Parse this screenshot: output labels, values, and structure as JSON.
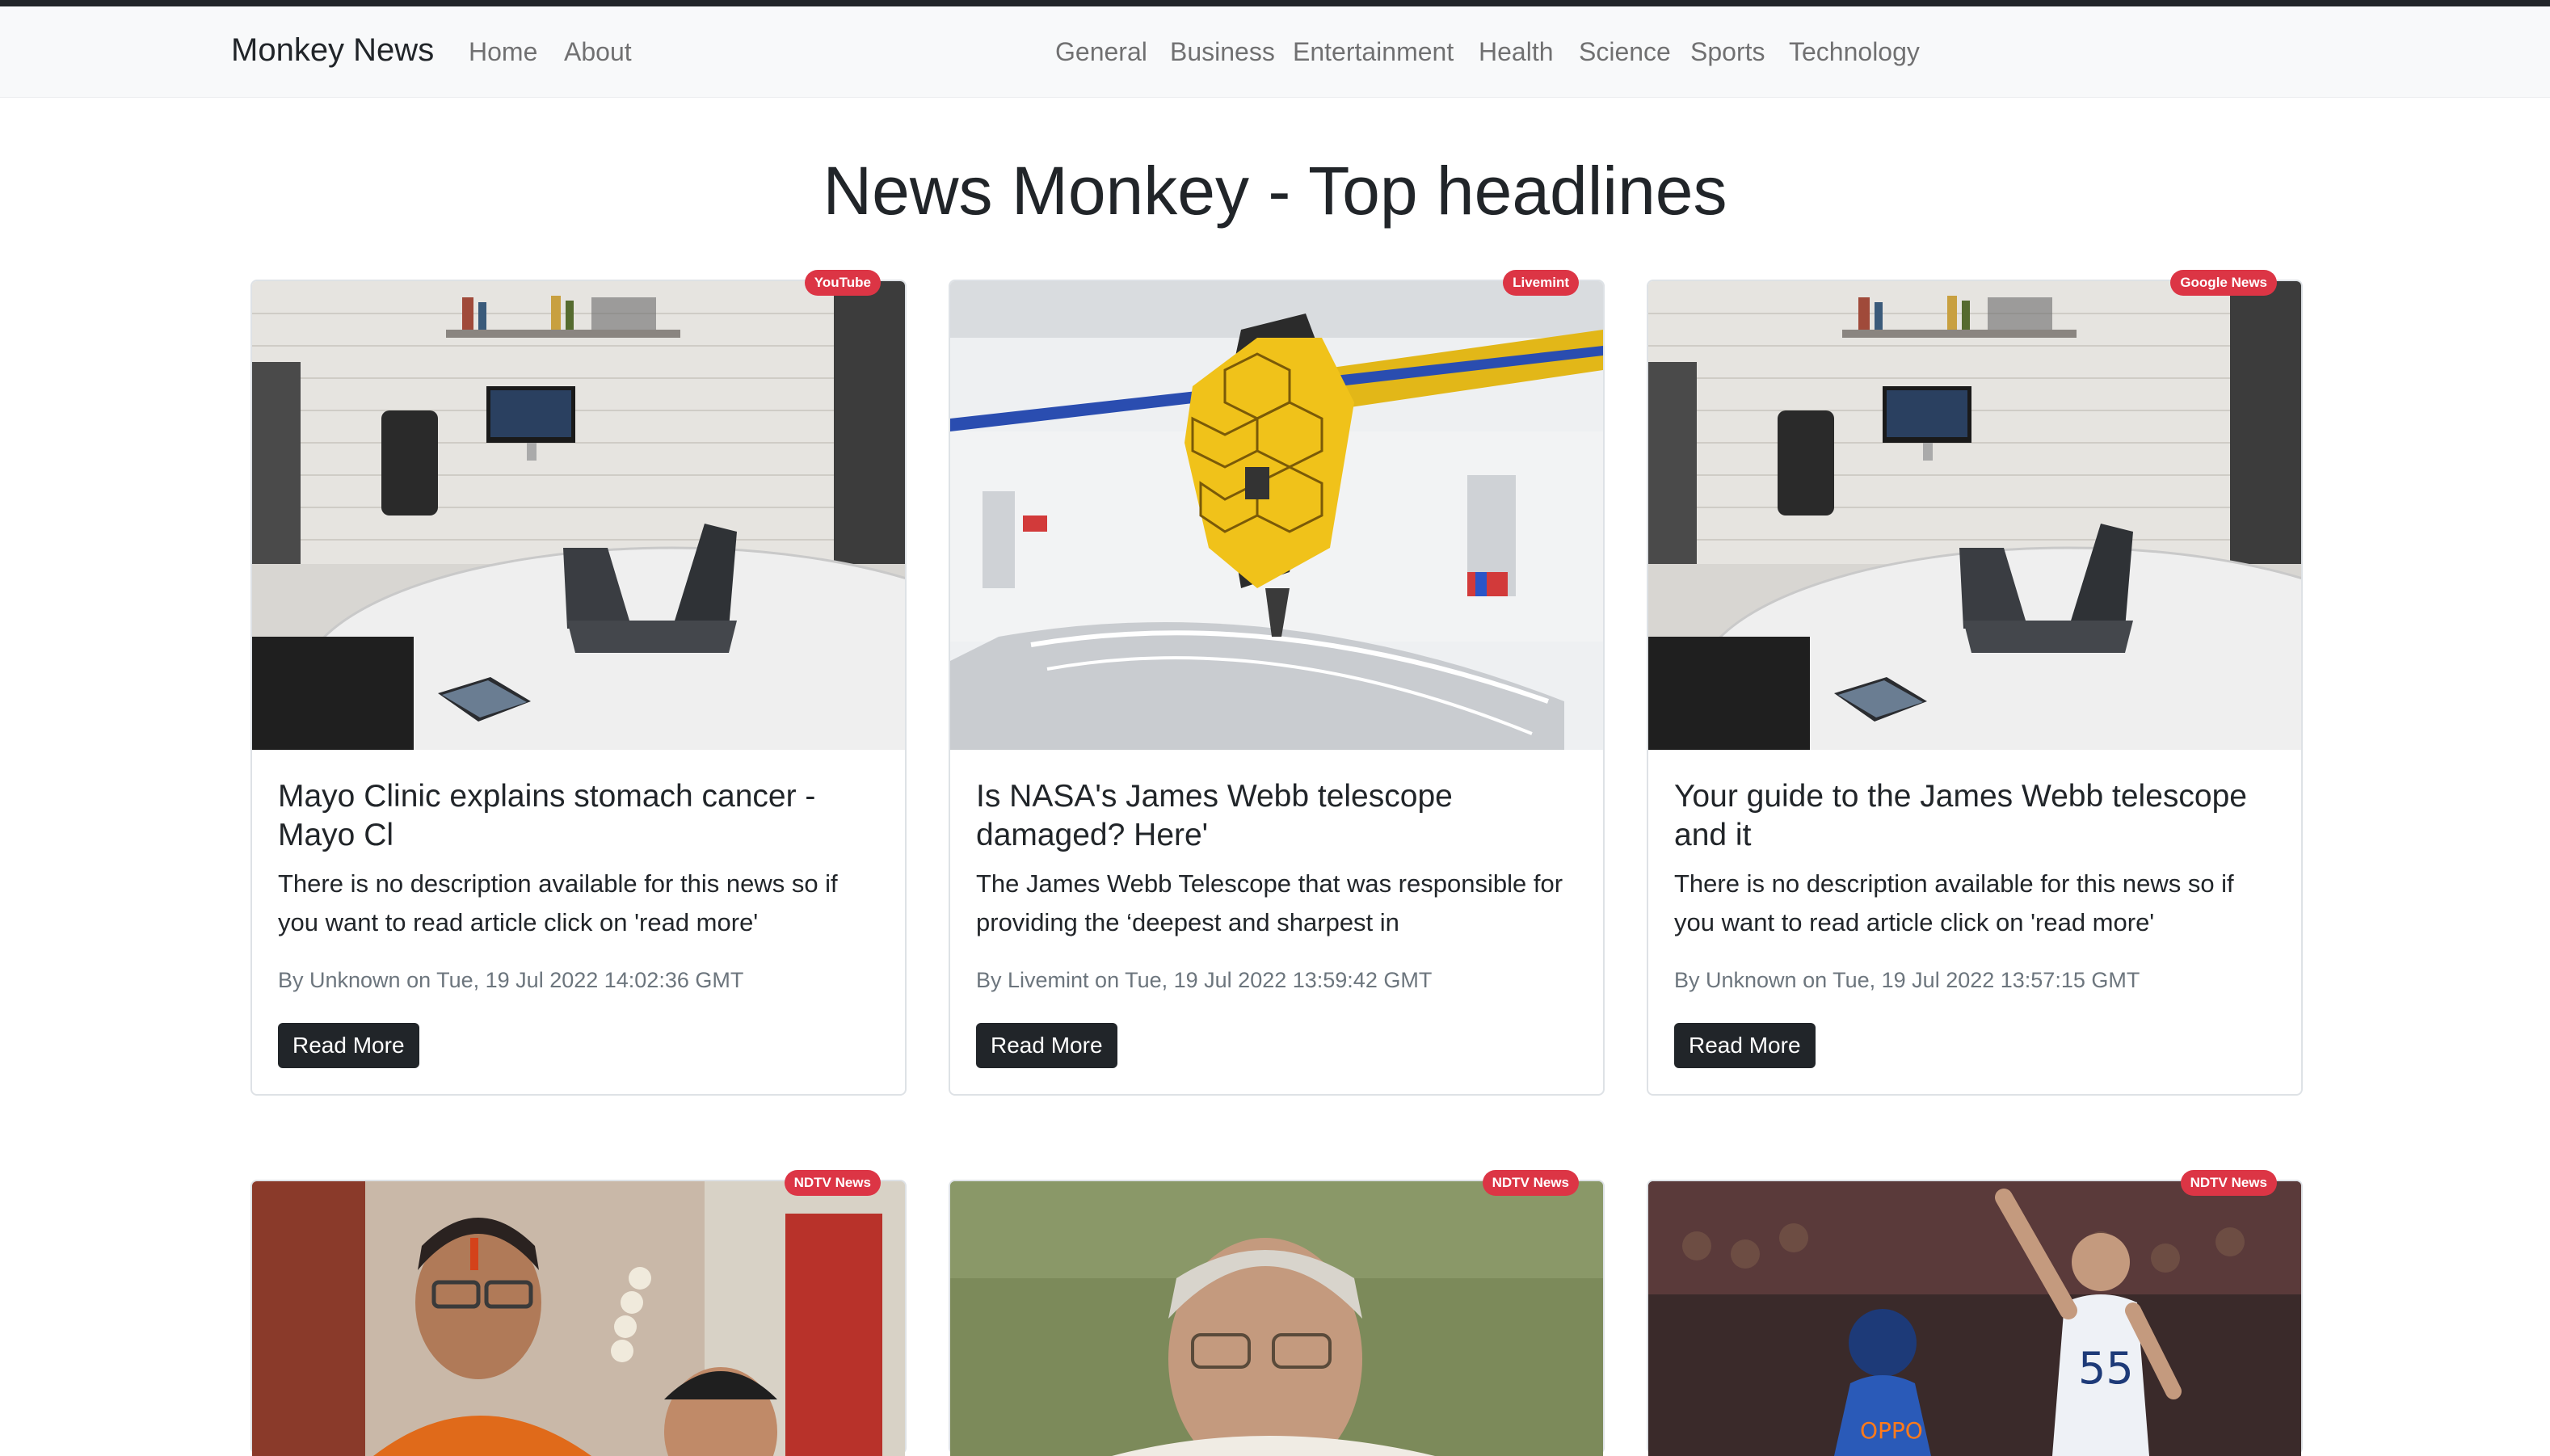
{
  "navbar": {
    "brand": "Monkey News",
    "links": [
      "Home",
      "About"
    ],
    "categories": [
      "General",
      "Business",
      "Entertainment",
      "Health",
      "Science",
      "Sports",
      "Technology"
    ]
  },
  "page": {
    "title": "News Monkey - Top headlines"
  },
  "colors": {
    "badge": "#dc3545",
    "button": "#212529",
    "navbar_bg": "#f8f9fa"
  },
  "articles": [
    {
      "source": "YouTube",
      "title": "Mayo Clinic explains stomach cancer - Mayo Cl",
      "description": "There is no description available for this news so if you want to read article click on 'read more'",
      "meta": "By Unknown on Tue, 19 Jul 2022 14:02:36 GMT",
      "button": "Read More",
      "image": "router-on-desk-photo"
    },
    {
      "source": "Livemint",
      "title": "Is NASA's James Webb telescope damaged? Here'",
      "description": "The James Webb Telescope that was responsible for providing the ‘deepest and sharpest in",
      "meta": "By Livemint on Tue, 19 Jul 2022 13:59:42 GMT",
      "button": "Read More",
      "image": "webb-telescope-photo"
    },
    {
      "source": "Google News",
      "title": "Your guide to the James Webb telescope and it",
      "description": "There is no description available for this news so if you want to read article click on 'read more'",
      "meta": "By Unknown on Tue, 19 Jul 2022 13:57:15 GMT",
      "button": "Read More",
      "image": "router-on-desk-photo"
    },
    {
      "source": "NDTV News",
      "image": "politician-photo"
    },
    {
      "source": "NDTV News",
      "image": "minister-photo"
    },
    {
      "source": "NDTV News",
      "image": "cricket-photo"
    }
  ]
}
